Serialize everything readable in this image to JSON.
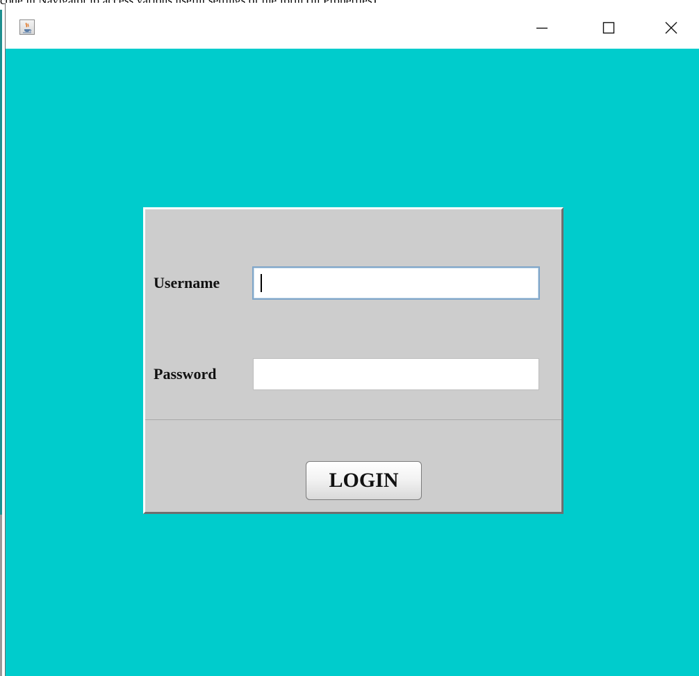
{
  "background_document": {
    "text": "code in Navigator to access various useful settings of the form (in Properties)"
  },
  "window": {
    "icon": "java-cup-icon",
    "controls": {
      "minimize_icon": "minimize-icon",
      "maximize_icon": "maximize-icon",
      "close_icon": "close-icon"
    },
    "background_color": "#00cccc"
  },
  "login_form": {
    "username_label": "Username",
    "username_value": "",
    "password_label": "Password",
    "password_value": "",
    "login_button_label": "LOGIN",
    "panel_color": "#cdcdcd"
  }
}
